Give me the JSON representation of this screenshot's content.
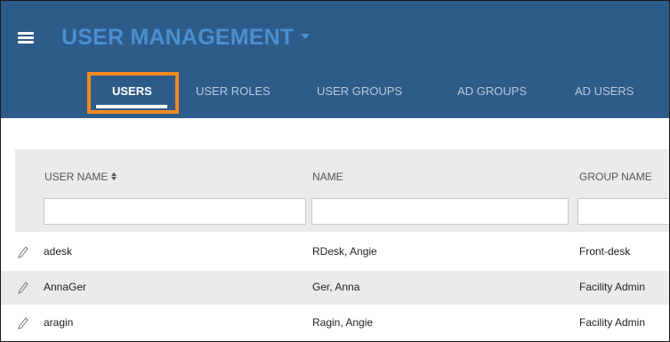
{
  "header": {
    "title": "USER MANAGEMENT",
    "menu_icon": "hamburger-menu-icon",
    "title_dropdown_icon": "caret-down-icon",
    "background_color": "#2e5c8a",
    "title_color": "#4a8fd0"
  },
  "tabs": [
    {
      "label": "USERS",
      "active": true
    },
    {
      "label": "USER ROLES",
      "active": false
    },
    {
      "label": "USER GROUPS",
      "active": false
    },
    {
      "label": "AD GROUPS",
      "active": false
    },
    {
      "label": "AD USERS",
      "active": false
    }
  ],
  "highlight_color": "#f28a22",
  "table": {
    "columns": [
      {
        "label": "USER NAME",
        "sortable": true,
        "filter_value": ""
      },
      {
        "label": "NAME",
        "sortable": false,
        "filter_value": ""
      },
      {
        "label": "GROUP NAME",
        "sortable": false,
        "filter_value": ""
      }
    ],
    "row_edit_icon": "pencil-edit-icon",
    "rows": [
      {
        "user_name": "adesk",
        "name": "RDesk, Angie",
        "group_name": "Front-desk"
      },
      {
        "user_name": "AnnaGer",
        "name": "Ger, Anna",
        "group_name": "Facility Admin"
      },
      {
        "user_name": "aragin",
        "name": "Ragin, Angie",
        "group_name": "Facility Admin"
      }
    ]
  }
}
